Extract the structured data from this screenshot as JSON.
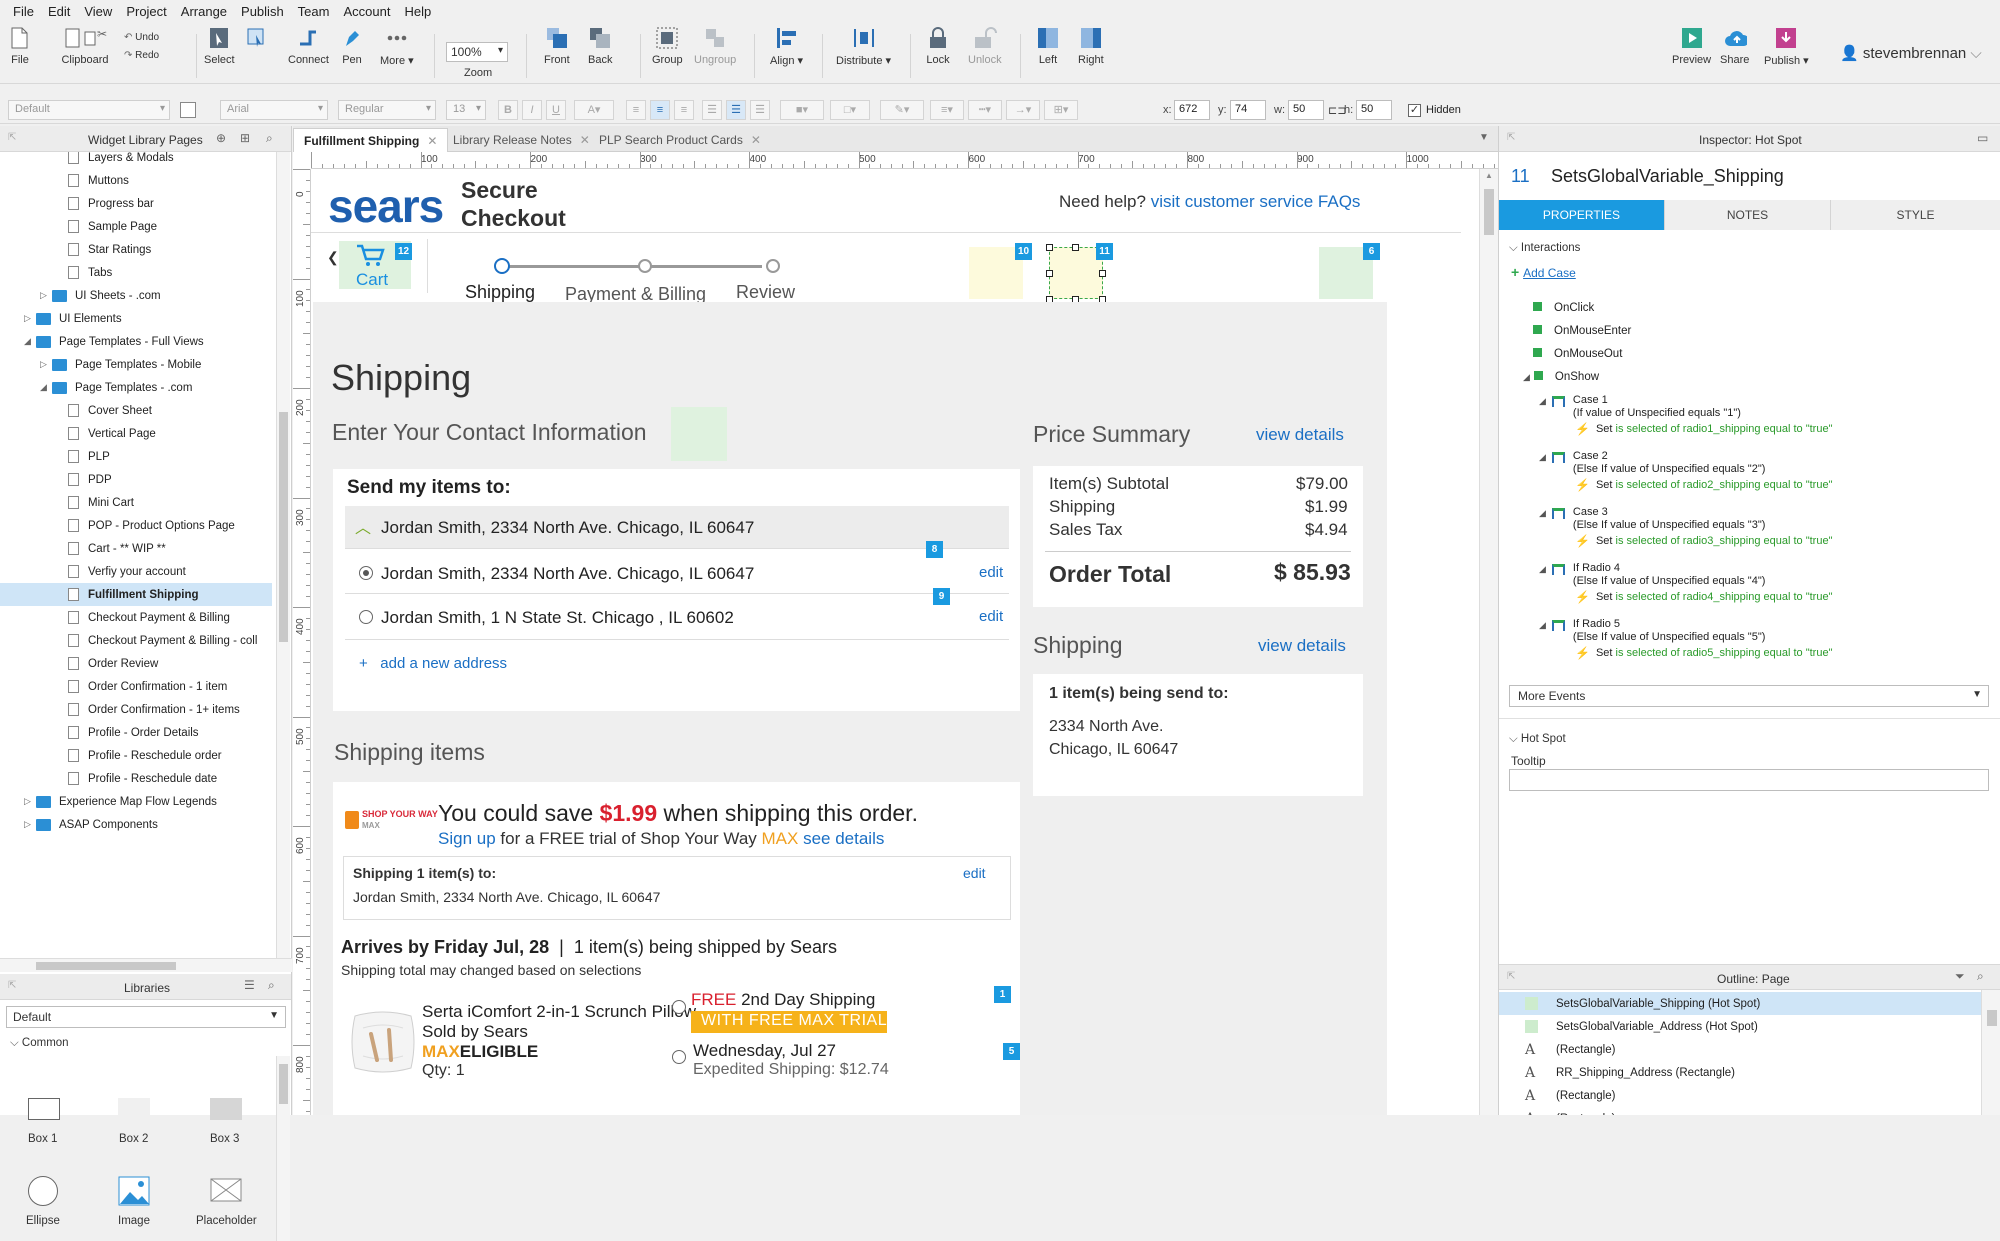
{
  "menu": [
    "File",
    "Edit",
    "View",
    "Project",
    "Arrange",
    "Publish",
    "Team",
    "Account",
    "Help"
  ],
  "toolbar": {
    "file": "File",
    "clipboard": "Clipboard",
    "undo": "Undo",
    "redo": "Redo",
    "select": "Select",
    "connect": "Connect",
    "pen": "Pen",
    "more": "More ▾",
    "zoom_value": "100%",
    "zoom": "Zoom",
    "front": "Front",
    "back": "Back",
    "group": "Group",
    "ungroup": "Ungroup",
    "align": "Align ▾",
    "distribute": "Distribute ▾",
    "lock": "Lock",
    "unlock": "Unlock",
    "left": "Left",
    "right": "Right",
    "preview": "Preview",
    "share": "Share",
    "publish": "Publish ▾",
    "user": "stevembrennan"
  },
  "format": {
    "style": "Default",
    "font": "Arial",
    "weight": "Regular",
    "size": "13",
    "x_label": "x:",
    "x": "672",
    "y_label": "y:",
    "y": "74",
    "w_label": "w:",
    "w": "50",
    "h_label": "h:",
    "h": "50",
    "hidden": "Hidden"
  },
  "left_panel": {
    "title": "Widget Library Pages",
    "tree": [
      {
        "label": "Layers & Modals",
        "type": "page",
        "indent": 2
      },
      {
        "label": "Muttons",
        "type": "page",
        "indent": 2
      },
      {
        "label": "Progress bar",
        "type": "page",
        "indent": 2
      },
      {
        "label": "Sample Page",
        "type": "page",
        "indent": 2
      },
      {
        "label": "Star Ratings",
        "type": "page",
        "indent": 2
      },
      {
        "label": "Tabs",
        "type": "page",
        "indent": 2
      },
      {
        "label": "UI Sheets - .com",
        "type": "folder",
        "indent": 1,
        "tw": "▷"
      },
      {
        "label": "UI Elements",
        "type": "folder",
        "indent": 0,
        "tw": "▷"
      },
      {
        "label": "Page Templates - Full Views",
        "type": "folder",
        "indent": 0,
        "tw": "◢"
      },
      {
        "label": "Page Templates - Mobile",
        "type": "folder",
        "indent": 1,
        "tw": "▷"
      },
      {
        "label": "Page Templates - .com",
        "type": "folder",
        "indent": 1,
        "tw": "◢"
      },
      {
        "label": "Cover Sheet",
        "type": "page",
        "indent": 2
      },
      {
        "label": "Vertical Page",
        "type": "page",
        "indent": 2
      },
      {
        "label": "PLP",
        "type": "page",
        "indent": 2
      },
      {
        "label": "PDP",
        "type": "page",
        "indent": 2
      },
      {
        "label": "Mini Cart",
        "type": "page",
        "indent": 2
      },
      {
        "label": "POP - Product Options Page",
        "type": "page",
        "indent": 2
      },
      {
        "label": "Cart - ** WIP **",
        "type": "page",
        "indent": 2
      },
      {
        "label": "Verfiy your account",
        "type": "page",
        "indent": 2
      },
      {
        "label": "Fulfillment Shipping",
        "type": "page",
        "indent": 2,
        "selected": true
      },
      {
        "label": "Checkout Payment & Billing",
        "type": "page",
        "indent": 2
      },
      {
        "label": "Checkout Payment & Billing - coll",
        "type": "page",
        "indent": 2
      },
      {
        "label": "Order Review",
        "type": "page",
        "indent": 2
      },
      {
        "label": "Order Confirmation - 1 item",
        "type": "page",
        "indent": 2
      },
      {
        "label": "Order Confirmation - 1+ items",
        "type": "page",
        "indent": 2
      },
      {
        "label": "Profile - Order Details",
        "type": "page",
        "indent": 2
      },
      {
        "label": "Profile - Reschedule order",
        "type": "page",
        "indent": 2
      },
      {
        "label": "Profile - Reschedule date",
        "type": "page",
        "indent": 2
      },
      {
        "label": "Experience Map Flow Legends",
        "type": "folder",
        "indent": 0,
        "tw": "▷"
      },
      {
        "label": "ASAP Components",
        "type": "folder",
        "indent": 0,
        "tw": "▷"
      }
    ],
    "libraries_title": "Libraries",
    "library_select": "Default",
    "common": "Common",
    "widgets": [
      "Box 1",
      "Box 2",
      "Box 3",
      "Ellipse",
      "Image",
      "Placeholder"
    ]
  },
  "tabs": [
    {
      "label": "Fulfillment Shipping",
      "active": true
    },
    {
      "label": "Library Release Notes"
    },
    {
      "label": "PLP Search Product Cards"
    }
  ],
  "ruler_h": [
    "100",
    "200",
    "300",
    "400",
    "500",
    "600",
    "700",
    "800",
    "900",
    "1000"
  ],
  "ruler_v": [
    "0",
    "100",
    "200",
    "300",
    "400",
    "500",
    "600",
    "700",
    "800"
  ],
  "page": {
    "logo": "sears",
    "secure1": "Secure",
    "secure2": "Checkout",
    "help": "Need help?",
    "help_link": "visit customer service FAQs",
    "cart": "Cart",
    "steps": [
      "Shipping",
      "Payment & Billing",
      "Review"
    ],
    "title": "Shipping",
    "contact": "Enter Your Contact Information",
    "send_to": "Send my items to:",
    "addresses": [
      "Jordan Smith, 2334 North Ave. Chicago, IL 60647",
      "Jordan Smith, 2334 North Ave. Chicago, IL 60647",
      "Jordan Smith, 1 N State St. Chicago , IL 60602"
    ],
    "edit": "edit",
    "add_address": "add a new address",
    "price_title": "Price Summary",
    "view_details": "view details",
    "subtotal_label": "Item(s) Subtotal",
    "subtotal": "$79.00",
    "shipping_label": "Shipping",
    "shipping": "$1.99",
    "tax_label": "Sales Tax",
    "tax": "$4.94",
    "total_label": "Order Total",
    "total": "$ 85.93",
    "ship_title": "Shipping",
    "ship_count": "1 item(s) being send to:",
    "ship_addr1": "2334 North Ave.",
    "ship_addr2": "Chicago, IL 60647",
    "items_title": "Shipping items",
    "syw_logo1": "SHOP YOUR WAY",
    "syw_logo2": "MAX",
    "save_a": "You could save ",
    "save_amt": "$1.99",
    "save_b": " when shipping this order.",
    "signup": "Sign up",
    "trial": " for a FREE trial of Shop Your Way ",
    "max": "MAX",
    "see": "see details",
    "shipping_to": "Shipping 1 item(s) to:",
    "shipping_to_addr": "Jordan Smith, 2334 North Ave. Chicago, IL 60647",
    "arrives": "Arrives by Friday Jul, 28",
    "arrives_sep": "|",
    "arrives_b": "1 item(s) being shipped by Sears",
    "shipping_note": "Shipping total may changed based on selections",
    "product": "Serta iComfort 2-in-1 Scrunch Pillow",
    "sold": "Sold by Sears",
    "max2": "MAX",
    "eligible": "ELIGIBLE",
    "qty": "Qty: 1",
    "free": "FREE",
    "free_b": " 2nd Day Shipping",
    "trial_badge": "WITH FREE MAX TRIAL",
    "wed": "Wednesday, Jul 27",
    "expedited": "Expedited Shipping: $12.74",
    "badges": [
      "12",
      "10",
      "11",
      "6",
      "8",
      "9",
      "1",
      "5"
    ]
  },
  "inspector": {
    "title": "Inspector: Hot Spot",
    "num": "11",
    "name": "SetsGlobalVariable_Shipping",
    "tabs": [
      "PROPERTIES",
      "NOTES",
      "STYLE"
    ],
    "interactions": "Interactions",
    "add_case": "Add Case",
    "events": [
      "OnClick",
      "OnMouseEnter",
      "OnMouseOut",
      "OnShow"
    ],
    "cases": [
      {
        "name": "Case 1",
        "cond": "(If value of Unspecified equals \"1\")",
        "set": "Set",
        "action": "is selected of radio1_shipping equal to \"true\""
      },
      {
        "name": "Case 2",
        "cond": "(Else If value of Unspecified equals \"2\")",
        "set": "Set",
        "action": "is selected of radio2_shipping equal to \"true\""
      },
      {
        "name": "Case 3",
        "cond": "(Else If value of Unspecified equals \"3\")",
        "set": "Set",
        "action": "is selected of radio3_shipping equal to \"true\""
      },
      {
        "name": "If Radio 4",
        "cond": "(Else If value of Unspecified equals \"4\")",
        "set": "Set",
        "action": "is selected of radio4_shipping equal to \"true\""
      },
      {
        "name": "If Radio 5",
        "cond": "(Else If value of Unspecified equals \"5\")",
        "set": "Set",
        "action": "is selected of radio5_shipping equal to \"true\""
      }
    ],
    "more_events": "More Events",
    "hotspot": "Hot Spot",
    "tooltip": "Tooltip"
  },
  "outline": {
    "title": "Outline: Page",
    "rows": [
      {
        "label": "SetsGlobalVariable_Shipping (Hot Spot)",
        "kind": "hs",
        "selected": true
      },
      {
        "label": "SetsGlobalVariable_Address (Hot Spot)",
        "kind": "hs"
      },
      {
        "label": "(Rectangle)",
        "kind": "a"
      },
      {
        "label": "RR_Shipping_Address (Rectangle)",
        "kind": "a"
      },
      {
        "label": "(Rectangle)",
        "kind": "a"
      },
      {
        "label": "(Rectangle)",
        "kind": "a"
      }
    ]
  }
}
